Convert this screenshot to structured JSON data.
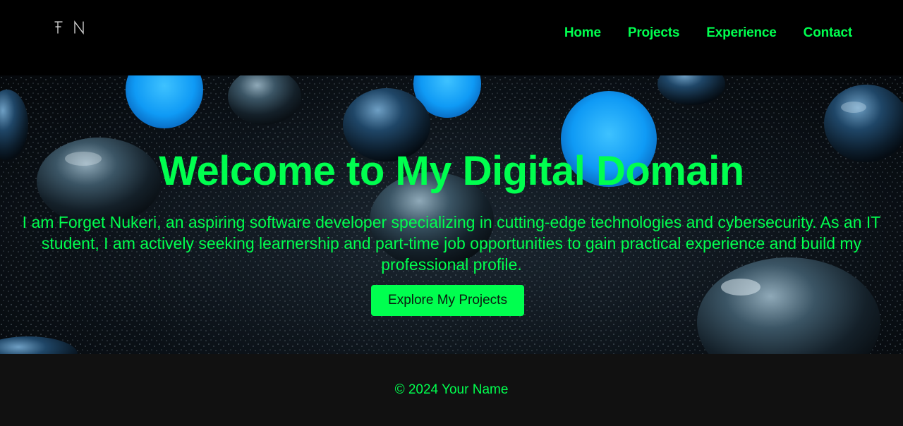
{
  "header": {
    "logo_alt": "FN"
  },
  "nav": {
    "items": [
      {
        "label": "Home"
      },
      {
        "label": "Projects"
      },
      {
        "label": "Experience"
      },
      {
        "label": "Contact"
      }
    ]
  },
  "hero": {
    "title": "Welcome to My Digital Domain",
    "text": "I am Forget Nukeri, an aspiring software developer specializing in cutting-edge technologies and cybersecurity. As an IT student, I am actively seeking learnership and part-time job opportunities to gain practical experience and build my professional profile.",
    "button_label": "Explore My Projects"
  },
  "footer": {
    "text": "© 2024 Your Name"
  },
  "colors": {
    "accent": "#00ff4f",
    "background": "#000000",
    "footer_background": "#111111",
    "sphere_glow": "#1aa7ff"
  }
}
